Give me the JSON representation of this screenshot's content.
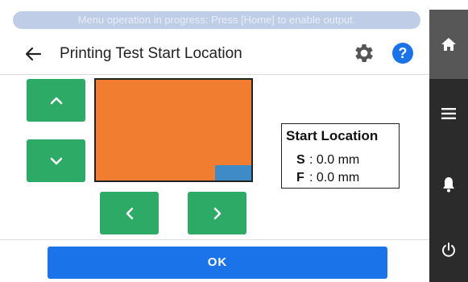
{
  "status": {
    "message": "Menu operation in progress: Press [Home] to enable output."
  },
  "header": {
    "title": "Printing Test Start Location",
    "back_icon": "arrow-left-icon",
    "settings_icon": "gear-icon",
    "help_label": "?"
  },
  "controls": {
    "up_icon": "chevron-up-icon",
    "down_icon": "chevron-down-icon",
    "left_icon": "chevron-left-icon",
    "right_icon": "chevron-right-icon"
  },
  "start_location": {
    "title": "Start Location",
    "s_label": "S",
    "s_value": ": 0.0 mm",
    "f_label": "F",
    "f_value": ": 0.0 mm"
  },
  "footer": {
    "ok_label": "OK"
  },
  "sidebar": {
    "items": [
      "home-icon",
      "menu-icon",
      "bell-icon",
      "power-icon"
    ]
  },
  "colors": {
    "accent_blue": "#1a73e8",
    "arrow_green": "#2eaa67",
    "media_orange": "#f07d30",
    "start_marker_blue": "#3f8bc8",
    "sidebar_dark": "#2b2b2b",
    "banner": "#bfcde6"
  }
}
